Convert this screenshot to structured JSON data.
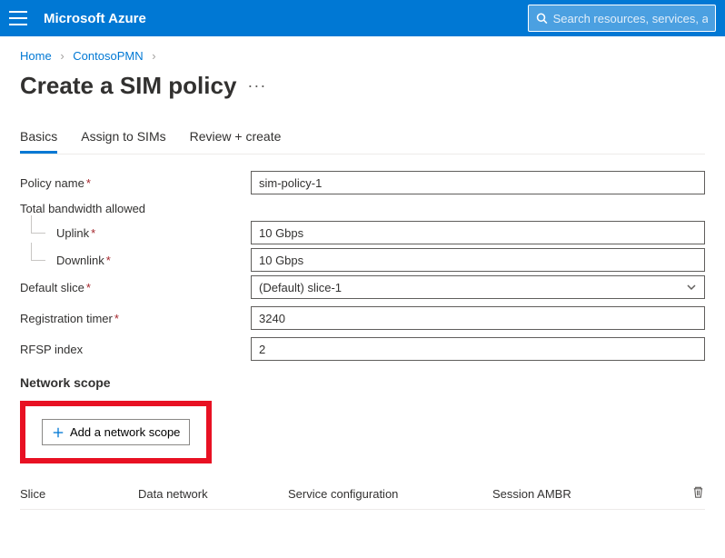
{
  "header": {
    "brand": "Microsoft Azure",
    "search_placeholder": "Search resources, services, and docs"
  },
  "breadcrumb": {
    "home": "Home",
    "resource": "ContosoPMN"
  },
  "title": "Create a SIM policy",
  "tabs": {
    "basics": "Basics",
    "assign": "Assign to SIMs",
    "review": "Review + create"
  },
  "form": {
    "policy_name_label": "Policy name",
    "policy_name_value": "sim-policy-1",
    "total_bw_label": "Total bandwidth allowed",
    "uplink_label": "Uplink",
    "uplink_value": "10 Gbps",
    "downlink_label": "Downlink",
    "downlink_value": "10 Gbps",
    "default_slice_label": "Default slice",
    "default_slice_value": "(Default) slice-1",
    "reg_timer_label": "Registration timer",
    "reg_timer_value": "3240",
    "rfsp_label": "RFSP index",
    "rfsp_value": "2"
  },
  "network_scope": {
    "heading": "Network scope",
    "add_button": "Add a network scope",
    "columns": {
      "slice": "Slice",
      "data_network": "Data network",
      "service_config": "Service configuration",
      "session_ambr": "Session AMBR"
    }
  }
}
